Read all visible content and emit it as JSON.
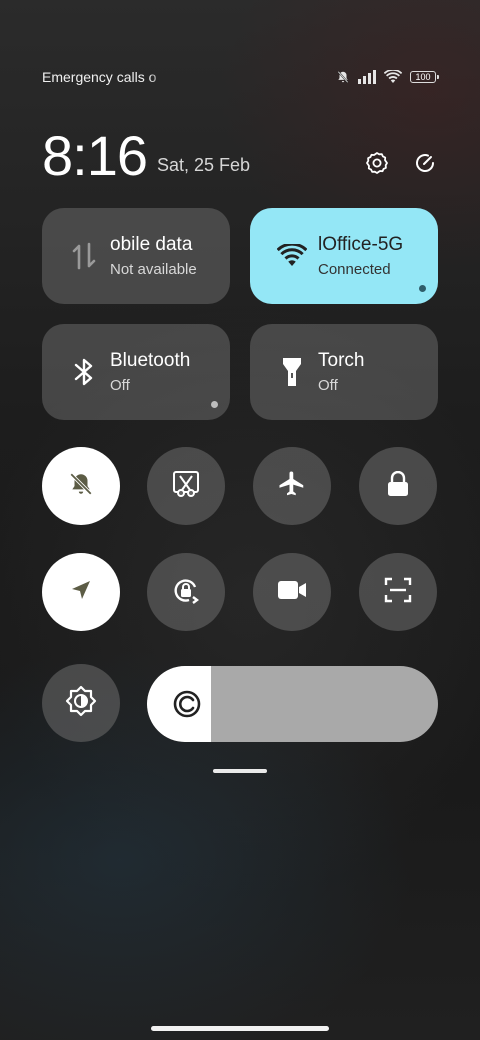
{
  "status_bar": {
    "carrier_text": "Emergency calls o",
    "icons": [
      "mute-icon",
      "signal-icon",
      "wifi-icon",
      "battery-icon"
    ],
    "battery_level": "100"
  },
  "clock": {
    "time": "8:16",
    "date": "Sat, 25 Feb",
    "actions": [
      "settings-icon",
      "edit-icon"
    ]
  },
  "tiles": {
    "mobile_data": {
      "title": "obile data",
      "subtitle": "Not available",
      "icon": "data-transfer-icon",
      "active": false
    },
    "wifi": {
      "title": "lOffice-5G",
      "subtitle": "Connected",
      "icon": "wifi-icon",
      "active": true
    },
    "bluetooth": {
      "title": "Bluetooth",
      "subtitle": "Off",
      "icon": "bluetooth-icon",
      "active": false
    },
    "torch": {
      "title": "Torch",
      "subtitle": "Off",
      "icon": "torch-icon",
      "active": false
    }
  },
  "toggles": [
    {
      "name": "silent",
      "icon": "bell-off-icon",
      "on": true
    },
    {
      "name": "screenshot",
      "icon": "scissors-icon",
      "on": false
    },
    {
      "name": "airplane-mode",
      "icon": "airplane-icon",
      "on": false
    },
    {
      "name": "lock-screen",
      "icon": "lock-icon",
      "on": false
    },
    {
      "name": "location",
      "icon": "location-arrow-icon",
      "on": true
    },
    {
      "name": "rotation-lock",
      "icon": "rotate-lock-icon",
      "on": false
    },
    {
      "name": "screen-recorder",
      "icon": "video-camera-icon",
      "on": false
    },
    {
      "name": "scanner",
      "icon": "scan-icon",
      "on": false
    },
    {
      "name": "auto-brightness",
      "icon": "auto-brightness-icon",
      "on": false
    }
  ],
  "brightness": {
    "level": 0.22,
    "icon": "brightness-icon"
  },
  "colors": {
    "active_tile": "#94e7f6",
    "tile": "#6f6f6f",
    "toggle_on": "#ffffff",
    "toggle_off": "#5a5a5a",
    "slider_track": "#a9a9a9"
  }
}
